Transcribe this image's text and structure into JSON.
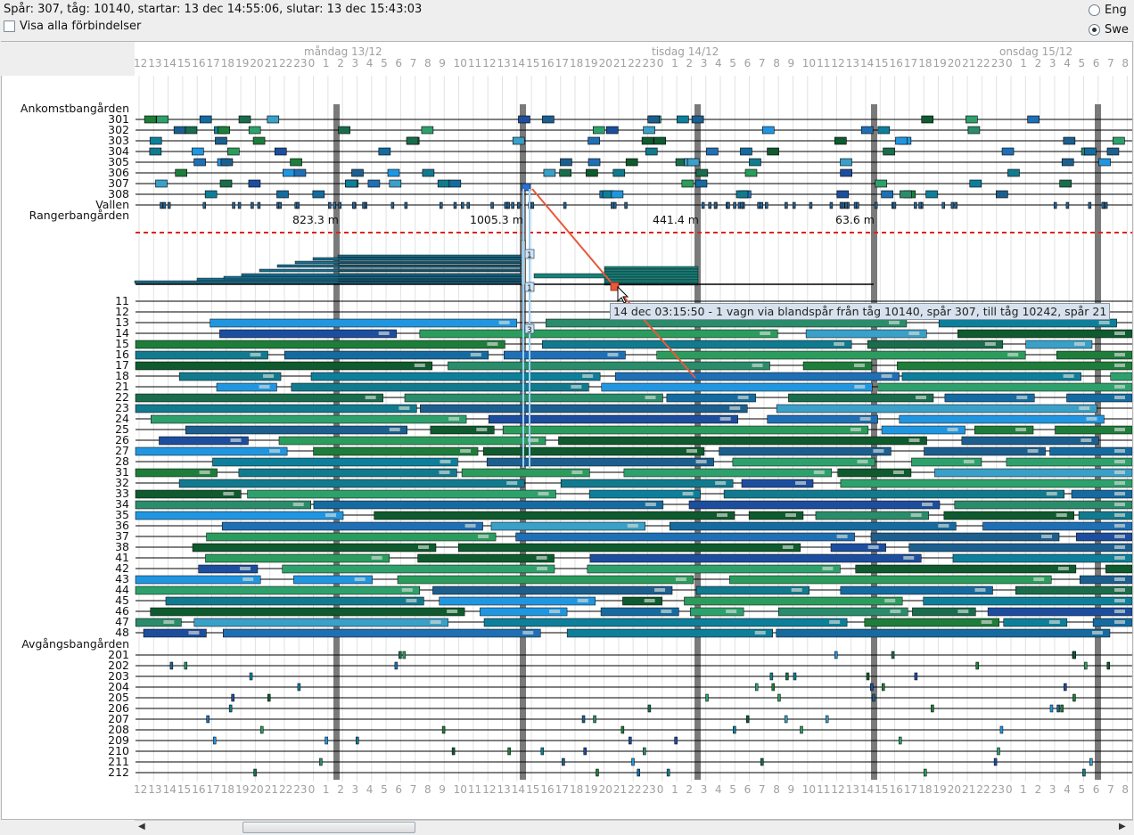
{
  "header": {
    "info_text": "Spår: 307, tåg: 10140, startar: 13 dec 14:55:06, slutar: 13 dec 15:43:03",
    "show_all_label": "Visa alla förbindelser",
    "show_all_checked": false,
    "languages": [
      {
        "label": "Eng",
        "selected": false
      },
      {
        "label": "Swe",
        "selected": true
      }
    ]
  },
  "timeline": {
    "day_labels": [
      "måndag 13/12",
      "tisdag 14/12",
      "onsdag 15/12"
    ],
    "hour_ticks": [
      "13",
      "14",
      "15",
      "16",
      "17",
      "18",
      "19",
      "20",
      "21",
      "22",
      "23",
      "0",
      "1",
      "2",
      "3",
      "4",
      "5",
      "6",
      "7",
      "8",
      "9",
      "10",
      "11",
      "12",
      "13",
      "14",
      "15",
      "16",
      "17",
      "18",
      "19",
      "20",
      "21",
      "22",
      "23",
      "0",
      "1",
      "2",
      "3",
      "4",
      "5",
      "6",
      "7",
      "8",
      "9",
      "10",
      "11",
      "12",
      "13",
      "14",
      "15",
      "16",
      "17",
      "18",
      "19",
      "20",
      "21",
      "22",
      "23",
      "0",
      "1",
      "2",
      "3",
      "4",
      "5",
      "6",
      "7",
      "8"
    ],
    "first_tick_label": "12",
    "shift_markers_hours": [
      2,
      15,
      3,
      16,
      7
    ]
  },
  "sections": {
    "arrival": "Ankomstbangården",
    "shunting": "Rangerbangården",
    "departure": "Avgångsbangården"
  },
  "arrival_tracks": [
    "301",
    "302",
    "303",
    "304",
    "305",
    "306",
    "307",
    "308",
    "Vallen"
  ],
  "classification_tracks": [
    "11",
    "12",
    "13",
    "14",
    "15",
    "16",
    "17",
    "18",
    "21",
    "22",
    "23",
    "24",
    "25",
    "26",
    "27",
    "28",
    "31",
    "32",
    "33",
    "34",
    "35",
    "36",
    "37",
    "38",
    "41",
    "42",
    "43",
    "44",
    "45",
    "46",
    "47",
    "48"
  ],
  "departure_tracks": [
    "201",
    "202",
    "203",
    "204",
    "205",
    "206",
    "207",
    "208",
    "209",
    "210",
    "211",
    "212"
  ],
  "hump_lengths": [
    "823.3 m",
    "1005.3 m",
    "441.4 m",
    "63.6 m"
  ],
  "stack_markers": [
    "1",
    "1",
    "3"
  ],
  "tooltip": "14 dec 03:15:50 - 1 vagn via blandspår från tåg 10140, spår 307, till tåg 10242, spår 21",
  "colors": {
    "shift_marker": "#7a7a7a",
    "highlight": "#e8583a",
    "selection": "#9fd0f0",
    "dashed_line": "#e02020"
  }
}
